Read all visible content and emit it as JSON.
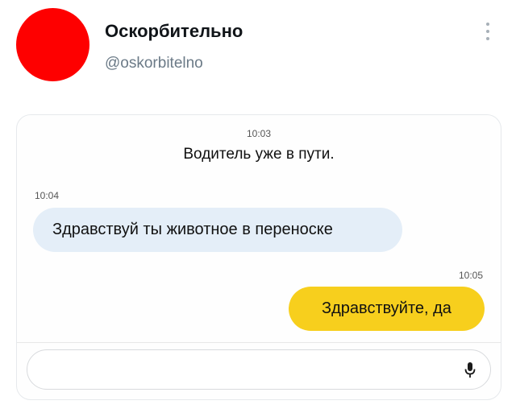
{
  "post": {
    "author_name": "Оскорбительно",
    "author_handle": "@oskorbitelno",
    "avatar_color": "#fe0000",
    "more_icon": "more-vertical-icon"
  },
  "chat": {
    "system_time": "10:03",
    "system_message": "Водитель уже в пути.",
    "incoming": {
      "time": "10:04",
      "text": "Здравствуй ты животное в переноске",
      "bubble_color": "#e4eef8"
    },
    "outgoing": {
      "time": "10:05",
      "text": "Здравствуйте, да",
      "bubble_color": "#f7cf1d"
    },
    "composer": {
      "value": "",
      "placeholder": "",
      "mic_icon": "microphone-icon"
    }
  }
}
